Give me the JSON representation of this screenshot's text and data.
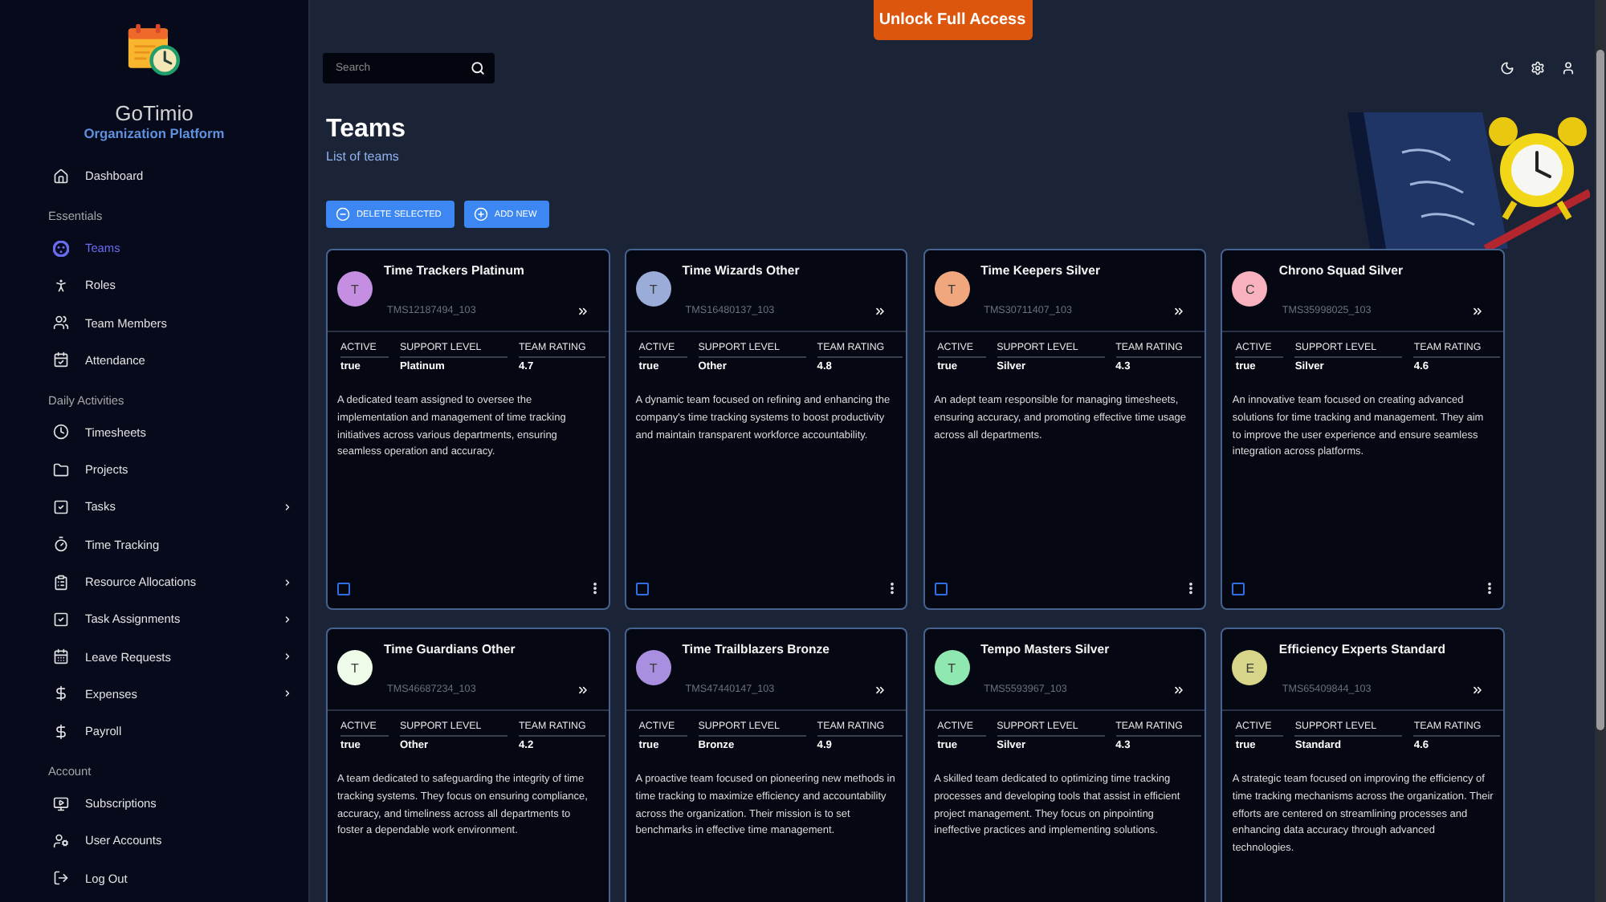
{
  "top_banner": {
    "button": "Unlock Full Access"
  },
  "sidebar": {
    "brand": "GoTimio",
    "subtitle": "Organization Platform",
    "items": [
      {
        "label": "Dashboard",
        "kind": "link",
        "selected": false
      }
    ],
    "sections": [
      {
        "title": "Essentials",
        "items": [
          {
            "label": "Teams",
            "kind": "link",
            "selected": true
          },
          {
            "label": "Roles",
            "kind": "link",
            "selected": false
          },
          {
            "label": "Team Members",
            "kind": "link",
            "selected": false
          },
          {
            "label": "Attendance",
            "kind": "link",
            "selected": false
          }
        ]
      },
      {
        "title": "Daily Activities",
        "items": [
          {
            "label": "Timesheets",
            "kind": "link",
            "selected": false
          },
          {
            "label": "Projects",
            "kind": "link",
            "selected": false
          },
          {
            "label": "Tasks",
            "kind": "group",
            "selected": false,
            "expanded": false
          },
          {
            "label": "Time Tracking",
            "kind": "link",
            "selected": false
          },
          {
            "label": "Resource Allocations",
            "kind": "group",
            "selected": false,
            "expanded": false
          },
          {
            "label": "Task Assignments",
            "kind": "group",
            "selected": false,
            "expanded": false
          },
          {
            "label": "Leave Requests",
            "kind": "group",
            "selected": false,
            "expanded": false
          },
          {
            "label": "Expenses",
            "kind": "group",
            "selected": false,
            "expanded": false
          },
          {
            "label": "Payroll",
            "kind": "link",
            "selected": false
          }
        ]
      },
      {
        "title": "Account",
        "items": [
          {
            "label": "Subscriptions",
            "kind": "link",
            "selected": false
          },
          {
            "label": "User Accounts",
            "kind": "link",
            "selected": false
          },
          {
            "label": "Log Out",
            "kind": "link",
            "selected": false
          }
        ]
      }
    ]
  },
  "toolbar": {
    "search": {
      "placeholder": "Search"
    }
  },
  "page": {
    "title": "Teams",
    "subtitle": "List of teams",
    "buttons": [
      {
        "label": "DELETE SELECTED",
        "kind": "delete"
      },
      {
        "label": "ADD NEW",
        "kind": "add"
      }
    ]
  },
  "cards": [
    {
      "initial": "T",
      "color": "#c48fe0",
      "name": "Time Trackers Platinum",
      "code": "TMS12187494_103",
      "fields": [
        {
          "label": "ACTIVE",
          "value": "true"
        },
        {
          "label": "SUPPORT LEVEL",
          "value": "Platinum"
        },
        {
          "label": "TEAM RATING",
          "value": "4.7"
        }
      ],
      "description": "A dedicated team assigned to oversee the implementation and management of time tracking initiatives across various departments, ensuring seamless operation and accuracy.",
      "checked": false
    },
    {
      "initial": "T",
      "color": "#9aacd8",
      "name": "Time Wizards Other",
      "code": "TMS16480137_103",
      "fields": [
        {
          "label": "ACTIVE",
          "value": "true"
        },
        {
          "label": "SUPPORT LEVEL",
          "value": "Other"
        },
        {
          "label": "TEAM RATING",
          "value": "4.8"
        }
      ],
      "description": "A dynamic team focused on refining and enhancing the company's time tracking systems to boost productivity and maintain transparent workforce accountability.",
      "checked": false
    },
    {
      "initial": "T",
      "color": "#f0a77e",
      "name": "Time Keepers Silver",
      "code": "TMS30711407_103",
      "fields": [
        {
          "label": "ACTIVE",
          "value": "true"
        },
        {
          "label": "SUPPORT LEVEL",
          "value": "Silver"
        },
        {
          "label": "TEAM RATING",
          "value": "4.3"
        }
      ],
      "description": "An adept team responsible for managing timesheets, ensuring accuracy, and promoting effective time usage across all departments.",
      "checked": false
    },
    {
      "initial": "C",
      "color": "#f7b2bd",
      "name": "Chrono Squad Silver",
      "code": "TMS35998025_103",
      "fields": [
        {
          "label": "ACTIVE",
          "value": "true"
        },
        {
          "label": "SUPPORT LEVEL",
          "value": "Silver"
        },
        {
          "label": "TEAM RATING",
          "value": "4.6"
        }
      ],
      "description": "An innovative team focused on creating advanced solutions for time tracking and management. They aim to improve the user experience and ensure seamless integration across platforms.",
      "checked": false
    },
    {
      "initial": "T",
      "color": "#eefbe8",
      "name": "Time Guardians Other",
      "code": "TMS46687234_103",
      "fields": [
        {
          "label": "ACTIVE",
          "value": "true"
        },
        {
          "label": "SUPPORT LEVEL",
          "value": "Other"
        },
        {
          "label": "TEAM RATING",
          "value": "4.2"
        }
      ],
      "description": "A team dedicated to safeguarding the integrity of time tracking systems. They focus on ensuring compliance, accuracy, and timeliness across all departments to foster a dependable work environment."
    },
    {
      "initial": "T",
      "color": "#a98fdf",
      "name": "Time Trailblazers Bronze",
      "code": "TMS47440147_103",
      "fields": [
        {
          "label": "ACTIVE",
          "value": "true"
        },
        {
          "label": "SUPPORT LEVEL",
          "value": "Bronze"
        },
        {
          "label": "TEAM RATING",
          "value": "4.9"
        }
      ],
      "description": "A proactive team focused on pioneering new methods in time tracking to maximize efficiency and accountability across the organization. Their mission is to set benchmarks in effective time management."
    },
    {
      "initial": "T",
      "color": "#8ee8b0",
      "name": "Tempo Masters Silver",
      "code": "TMS5593967_103",
      "fields": [
        {
          "label": "ACTIVE",
          "value": "true"
        },
        {
          "label": "SUPPORT LEVEL",
          "value": "Silver"
        },
        {
          "label": "TEAM RATING",
          "value": "4.3"
        }
      ],
      "description": "A skilled team dedicated to optimizing time tracking processes and developing tools that assist in efficient project management. They focus on pinpointing ineffective practices and implementing solutions."
    },
    {
      "initial": "E",
      "color": "#d6d58a",
      "name": "Efficiency Experts Standard",
      "code": "TMS65409844_103",
      "fields": [
        {
          "label": "ACTIVE",
          "value": "true"
        },
        {
          "label": "SUPPORT LEVEL",
          "value": "Standard"
        },
        {
          "label": "TEAM RATING",
          "value": "4.6"
        }
      ],
      "description": "A strategic team focused on improving the efficiency of time tracking mechanisms across the organization. Their efforts are centered on streamlining processes and enhancing data accuracy through advanced technologies."
    }
  ]
}
